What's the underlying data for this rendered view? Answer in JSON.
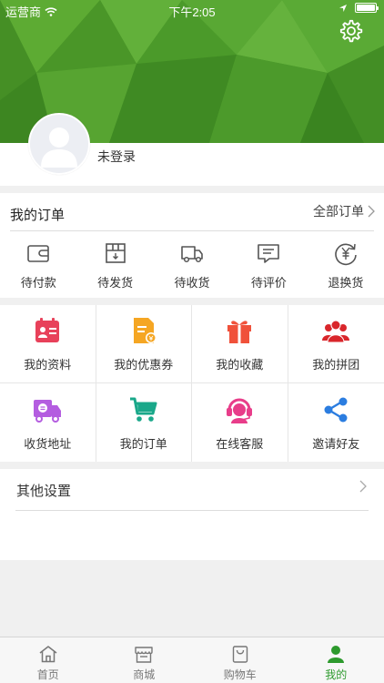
{
  "status_bar": {
    "carrier": "运营商",
    "time": "下午2:05",
    "battery_level": 0.9
  },
  "profile": {
    "login_status": "未登录"
  },
  "orders": {
    "title": "我的订单",
    "all_label": "全部订单",
    "items": [
      {
        "label": "待付款",
        "icon": "wallet-icon"
      },
      {
        "label": "待发货",
        "icon": "package-icon"
      },
      {
        "label": "待收货",
        "icon": "truck-icon"
      },
      {
        "label": "待评价",
        "icon": "comment-icon"
      },
      {
        "label": "退换货",
        "icon": "refund-icon"
      }
    ]
  },
  "features": [
    {
      "label": "我的资料",
      "icon": "profile-card-icon",
      "color": "#e8415a"
    },
    {
      "label": "我的优惠券",
      "icon": "coupon-icon",
      "color": "#f5a623"
    },
    {
      "label": "我的收藏",
      "icon": "gift-icon",
      "color": "#f0513a"
    },
    {
      "label": "我的拼团",
      "icon": "group-icon",
      "color": "#d9262b"
    },
    {
      "label": "收货地址",
      "icon": "delivery-truck-icon",
      "color": "#b45de0"
    },
    {
      "label": "我的订单",
      "icon": "cart-icon",
      "color": "#1aa88a"
    },
    {
      "label": "在线客服",
      "icon": "headset-icon",
      "color": "#e83d8a"
    },
    {
      "label": "邀请好友",
      "icon": "share-icon",
      "color": "#2b7de0"
    }
  ],
  "other_settings": {
    "label": "其他设置"
  },
  "tabbar": {
    "tabs": [
      {
        "label": "首页",
        "icon": "home-icon"
      },
      {
        "label": "商城",
        "icon": "store-icon"
      },
      {
        "label": "购物车",
        "icon": "bag-icon"
      },
      {
        "label": "我的",
        "icon": "user-icon",
        "active": true
      }
    ]
  },
  "colors": {
    "header_green": "#4a9a2a",
    "active_tab": "#2d9a2d",
    "order_icon": "#555555"
  }
}
